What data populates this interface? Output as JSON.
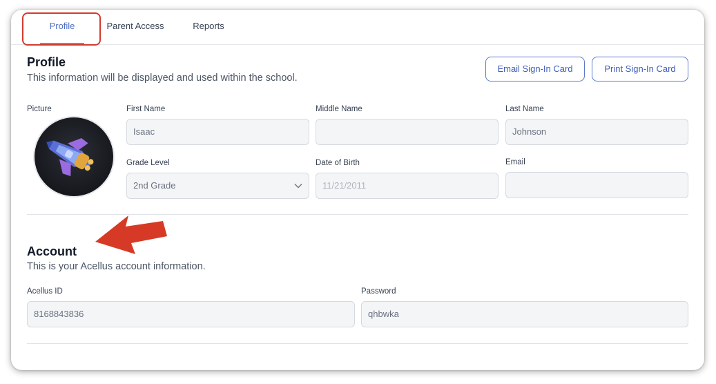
{
  "tabs": [
    {
      "label": "Profile",
      "active": true
    },
    {
      "label": "Parent Access",
      "active": false
    },
    {
      "label": "Reports",
      "active": false
    }
  ],
  "profile": {
    "title": "Profile",
    "subtitle": "This information will be displayed and used within the school.",
    "email_card_label": "Email Sign-In Card",
    "print_card_label": "Print Sign-In Card",
    "picture_label": "Picture",
    "first_name_label": "First Name",
    "first_name_value": "Isaac",
    "middle_name_label": "Middle Name",
    "middle_name_value": "",
    "last_name_label": "Last Name",
    "last_name_value": "Johnson",
    "grade_level_label": "Grade Level",
    "grade_level_value": "2nd Grade",
    "dob_label": "Date of Birth",
    "dob_value": "11/21/2011",
    "email_label": "Email",
    "email_value": ""
  },
  "account": {
    "title": "Account",
    "subtitle": "This is your Acellus account information.",
    "acellus_id_label": "Acellus ID",
    "acellus_id_value": "8168843836",
    "password_label": "Password",
    "password_value": "qhbwka"
  },
  "colors": {
    "accent": "#4f6fc7",
    "annotation_red": "#d33b2c"
  }
}
